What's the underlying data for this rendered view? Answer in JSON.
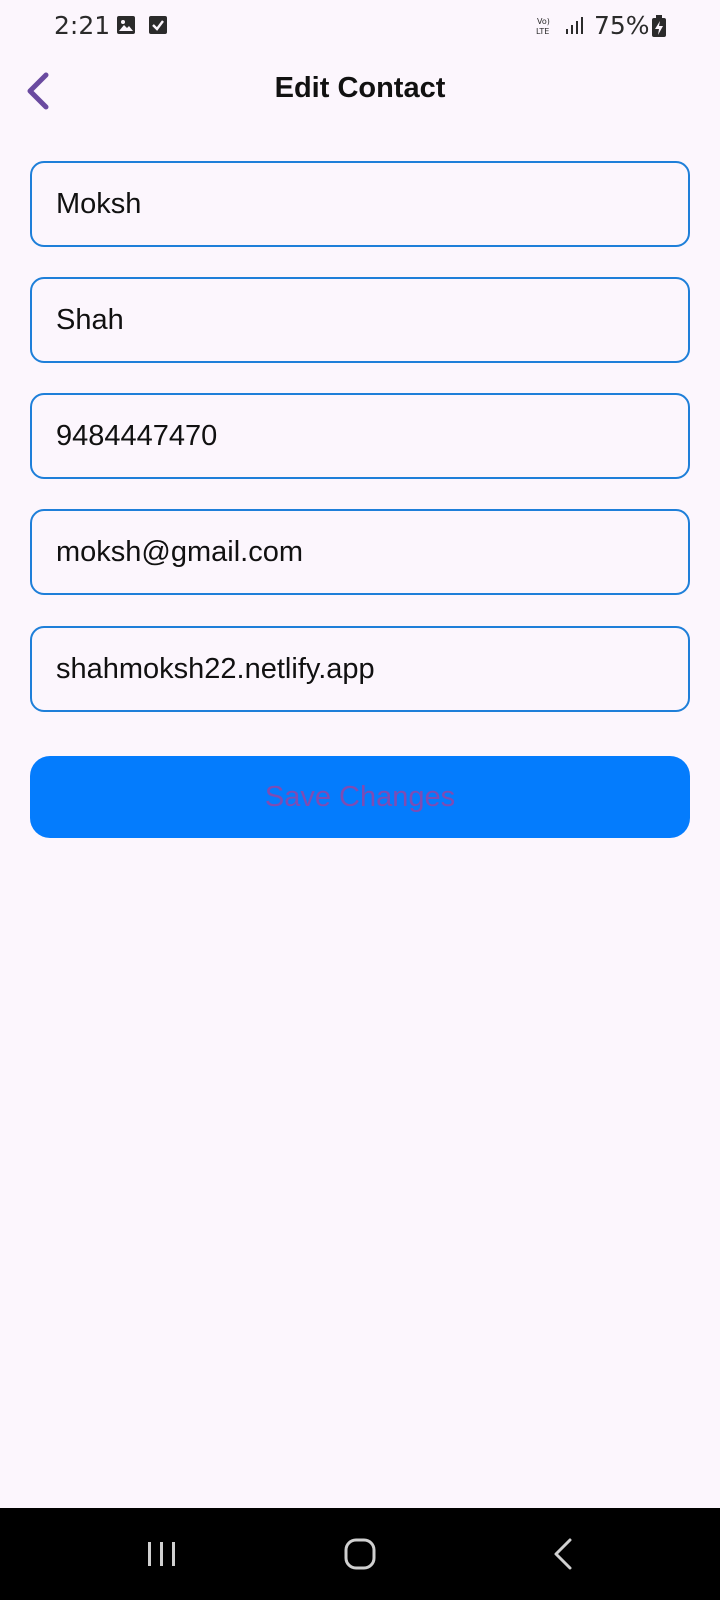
{
  "status_bar": {
    "time": "2:21",
    "battery": "75%",
    "icons": [
      "gallery-icon",
      "checkbox-icon",
      "volte-icon",
      "signal-icon",
      "battery-charging-icon"
    ]
  },
  "header": {
    "title": "Edit Contact",
    "back_icon": "chevron-left-icon"
  },
  "form": {
    "first_name": "Moksh",
    "last_name": "Shah",
    "phone": "9484447470",
    "email": "moksh@gmail.com",
    "website": "shahmoksh22.netlify.app",
    "save_label": "Save Changes"
  },
  "nav_bar": {
    "icons": [
      "recents-icon",
      "home-icon",
      "back-icon"
    ]
  },
  "colors": {
    "background": "#fcf6fd",
    "field_border": "#1e7fd9",
    "button_bg": "#047cfd",
    "button_text": "#7e4cb3",
    "back_arrow": "#6a4aa0"
  }
}
